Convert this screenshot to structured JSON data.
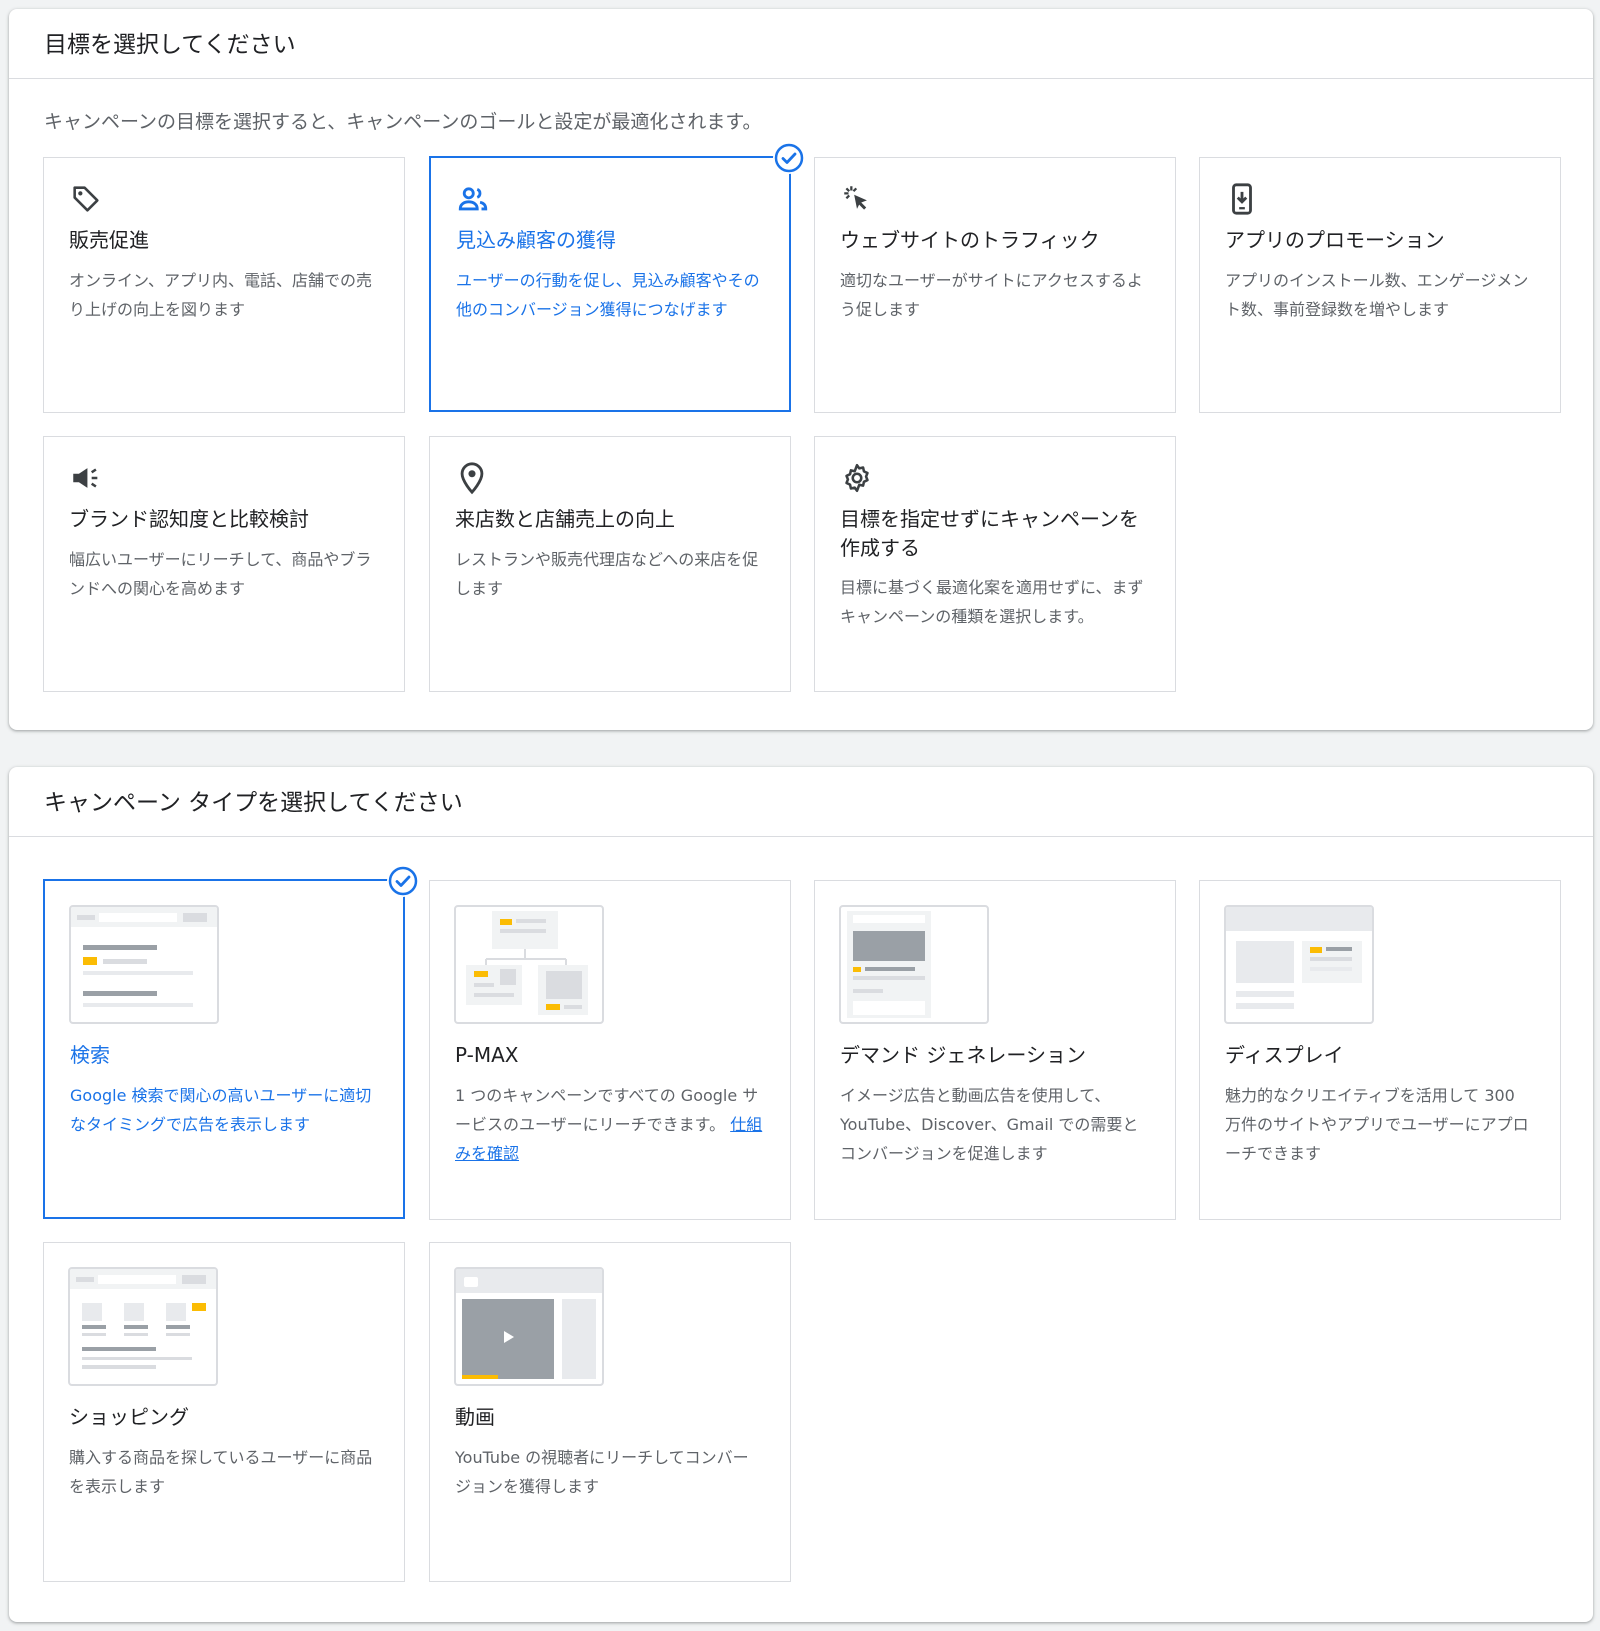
{
  "goal_section": {
    "heading": "目標を選択してください",
    "description": "キャンペーンの目標を選択すると、キャンペーンのゴールと設定が最適化されます。",
    "cards": [
      {
        "title": "販売促進",
        "description": "オンライン、アプリ内、電話、店舗での売り上げの向上を図ります",
        "icon": "tag-icon",
        "selected": false
      },
      {
        "title": "見込み顧客の獲得",
        "description": "ユーザーの行動を促し、見込み顧客やその他のコンバージョン獲得につなげます",
        "icon": "people-icon",
        "selected": true
      },
      {
        "title": "ウェブサイトのトラフィック",
        "description": "適切なユーザーがサイトにアクセスするよう促します",
        "icon": "cursor-click-icon",
        "selected": false
      },
      {
        "title": "アプリのプロモーション",
        "description": "アプリのインストール数、エンゲージメント数、事前登録数を増やします",
        "icon": "phone-download-icon",
        "selected": false
      },
      {
        "title": "ブランド認知度と比較検討",
        "description": "幅広いユーザーにリーチして、商品やブランドへの関心を高めます",
        "icon": "megaphone-icon",
        "selected": false
      },
      {
        "title": "来店数と店舗売上の向上",
        "description": "レストランや販売代理店などへの来店を促します",
        "icon": "location-pin-icon",
        "selected": false
      },
      {
        "title": "目標を指定せずにキャンペーンを作成する",
        "description": "目標に基づく最適化案を適用せずに、まずキャンペーンの種類を選択します。",
        "icon": "gear-icon",
        "selected": false
      }
    ]
  },
  "type_section": {
    "heading": "キャンペーン タイプを選択してください",
    "cards": [
      {
        "title": "検索",
        "description": "Google 検索で関心の高いユーザーに適切なタイミングで広告を表示します",
        "selected": true
      },
      {
        "title": "P-MAX",
        "description": "1 つのキャンペーンですべての Google サービスのユーザーにリーチできます。",
        "link": "仕組みを確認",
        "selected": false
      },
      {
        "title": "デマンド ジェネレーション",
        "description": "イメージ広告と動画広告を使用して、YouTube、Discover、Gmail での需要とコンバージョンを促進します",
        "selected": false
      },
      {
        "title": "ディスプレイ",
        "description": "魅力的なクリエイティブを活用して 300 万件のサイトやアプリでユーザーにアプローチできます",
        "selected": false
      },
      {
        "title": "ショッピング",
        "description": "購入する商品を探しているユーザーに商品を表示します",
        "selected": false
      },
      {
        "title": "動画",
        "description": "YouTube の視聴者にリーチしてコンバージョンを獲得します",
        "selected": false
      }
    ]
  },
  "colors": {
    "accent": "#1a73e8",
    "illustration_yellow": "#fbbc04",
    "illustration_gray": "#dadce0"
  }
}
